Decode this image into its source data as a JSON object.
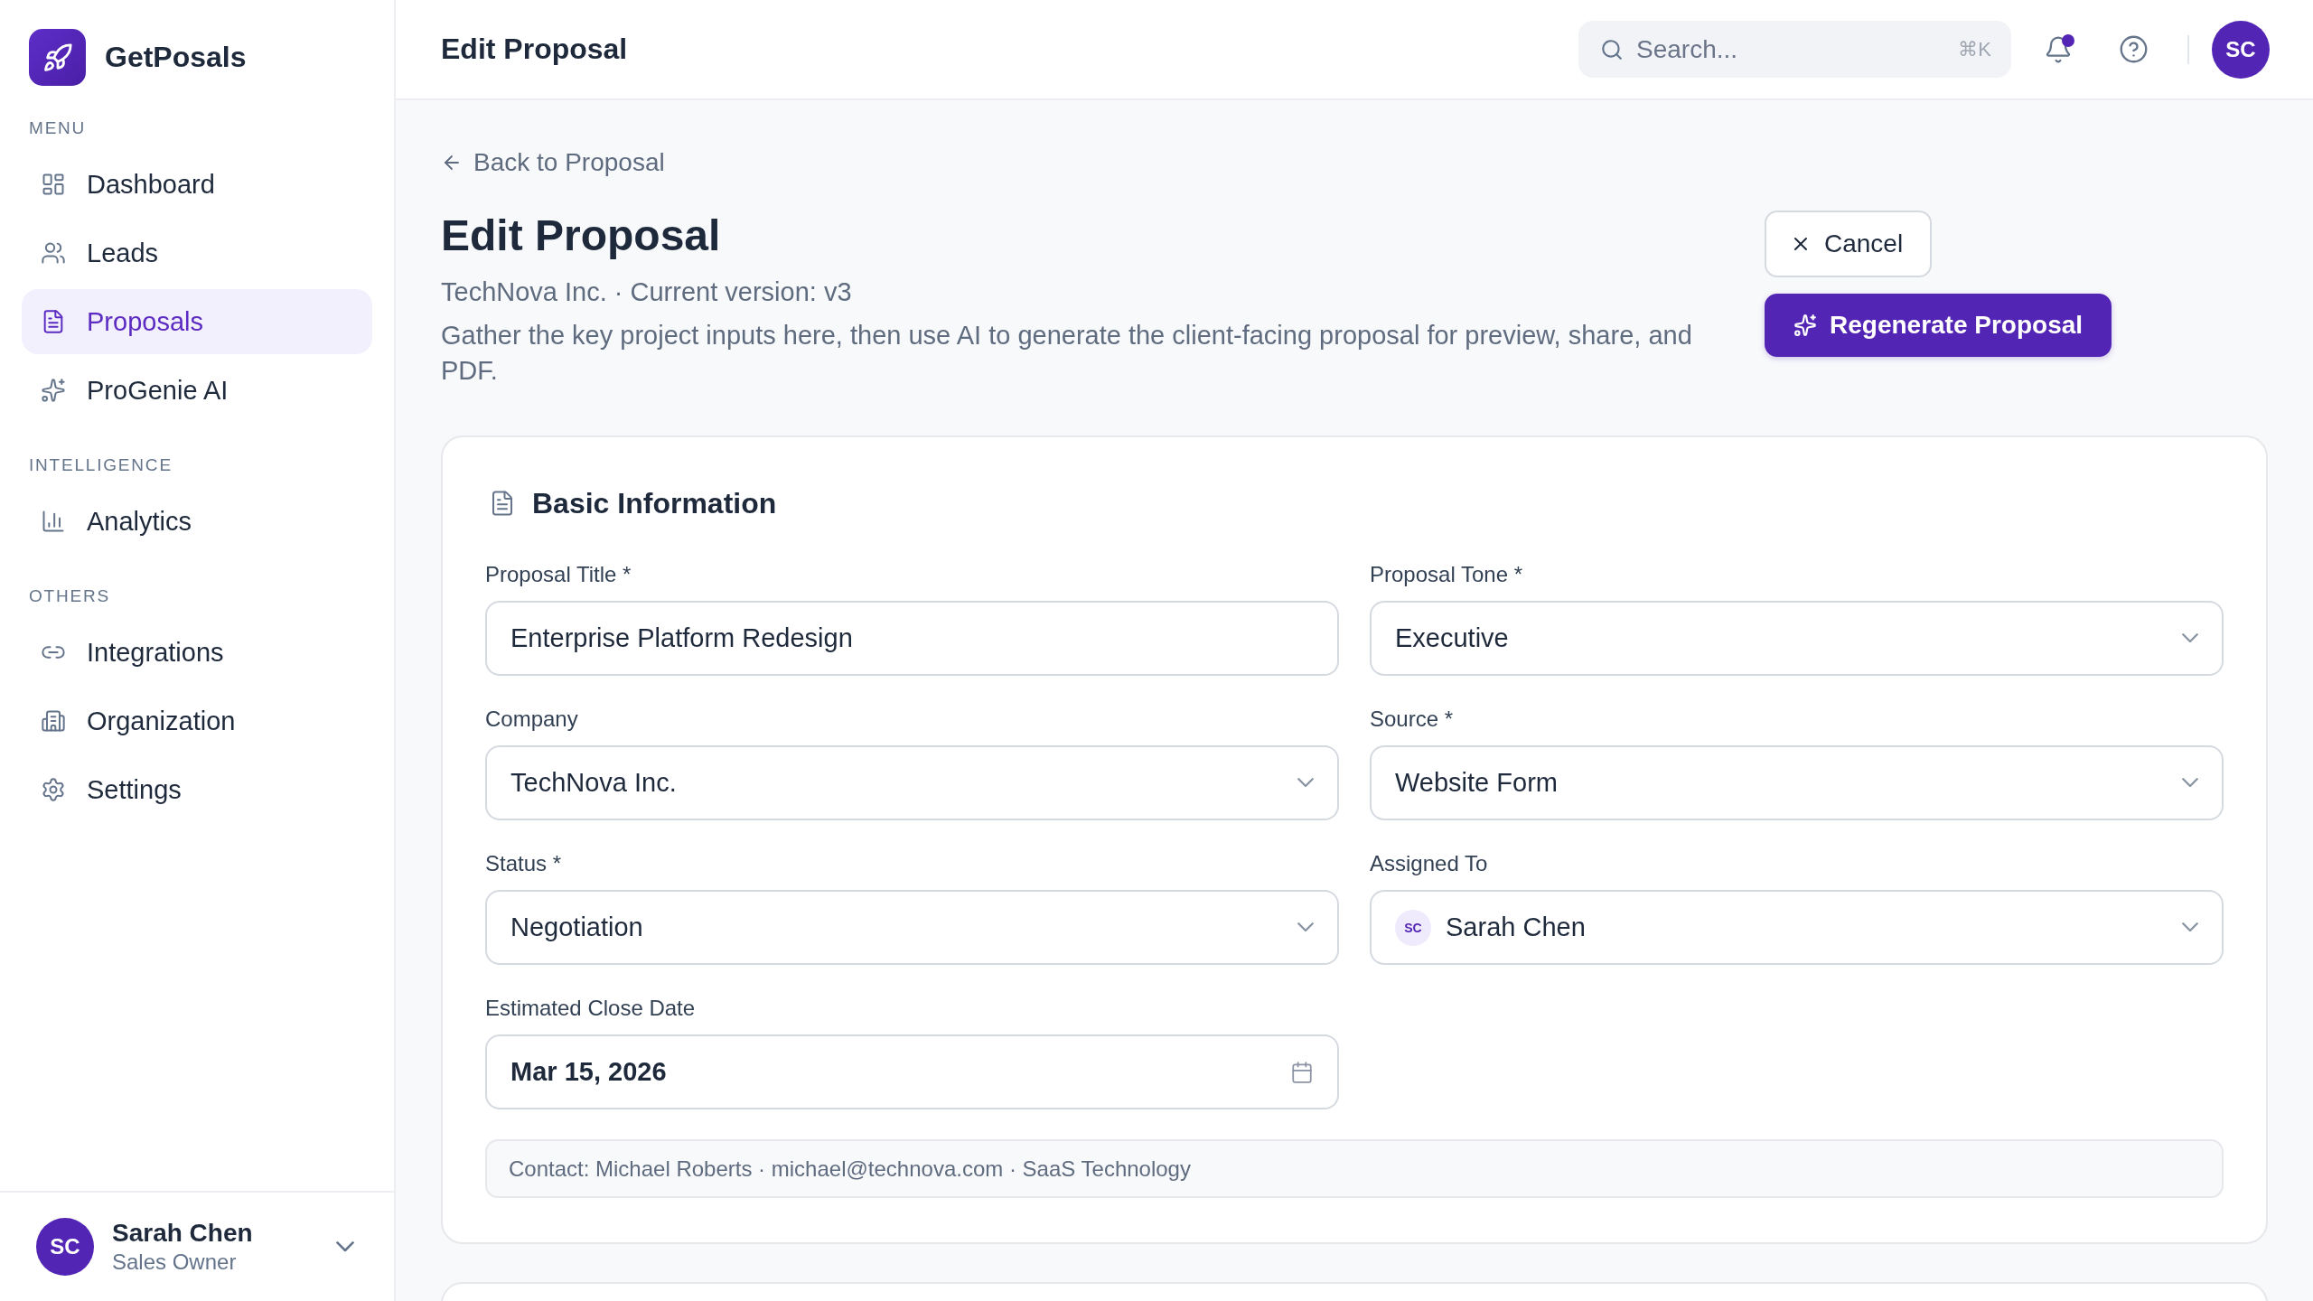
{
  "sidebar": {
    "brand": "GetPosals",
    "sections": [
      {
        "heading": "MENU",
        "items": [
          {
            "label": "Dashboard",
            "selected": false
          },
          {
            "label": "Leads",
            "selected": false
          },
          {
            "label": "Proposals",
            "selected": true
          },
          {
            "label": "ProGenie AI",
            "selected": false
          }
        ]
      },
      {
        "heading": "INTELLIGENCE",
        "items": [
          {
            "label": "Analytics",
            "selected": false
          }
        ]
      },
      {
        "heading": "OTHERS",
        "items": [
          {
            "label": "Integrations",
            "selected": false
          },
          {
            "label": "Organization",
            "selected": false
          },
          {
            "label": "Settings",
            "selected": false
          }
        ]
      }
    ],
    "user": {
      "initials": "SC",
      "name": "Sarah Chen",
      "role": "Sales Owner"
    }
  },
  "header": {
    "title": "Edit Proposal",
    "search": {
      "placeholder": "Search...",
      "shortcut": "⌘K"
    },
    "notifications": {
      "unread": true
    },
    "user_initials": "SC"
  },
  "page": {
    "back_link": "Back to Proposal",
    "title": "Edit Proposal",
    "subtitle": "TechNova Inc. · Current version: v3",
    "description": "Gather the key project inputs here, then use AI to generate the client-facing proposal for preview, share, and PDF.",
    "buttons": [
      {
        "label": "Cancel",
        "kind": "secondary"
      },
      {
        "label": "Regenerate Proposal",
        "kind": "primary"
      }
    ]
  },
  "basic_information": {
    "heading": "Basic Information",
    "fields": [
      {
        "label": "Proposal Title *",
        "kind": "text",
        "value": "Enterprise Platform Redesign"
      },
      {
        "label": "Proposal Tone *",
        "kind": "select",
        "value": "Executive"
      },
      {
        "label": "Company",
        "kind": "select",
        "value": "TechNova Inc."
      },
      {
        "label": "Source *",
        "kind": "select",
        "value": "Website Form"
      },
      {
        "label": "Status *",
        "kind": "select",
        "value": "Negotiation"
      },
      {
        "label": "Assigned To",
        "kind": "person",
        "initials": "SC",
        "value": "Sarah Chen"
      },
      {
        "label": "Estimated Close Date",
        "kind": "date",
        "value": "Mar 15, 2026"
      }
    ],
    "contact_note": "Contact: Michael Roberts · michael@technova.com · SaaS Technology"
  }
}
